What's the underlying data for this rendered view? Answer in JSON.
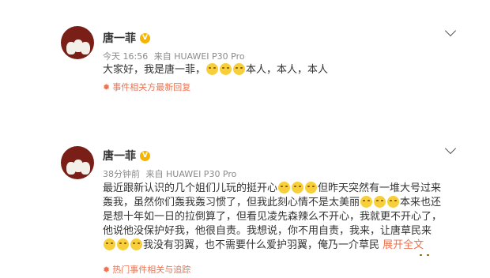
{
  "posts": [
    {
      "author": "唐一菲",
      "verified_icon": "v-badge-icon",
      "time": "今天 16:56",
      "source": "来自 HUAWEI P30 Pro",
      "content": {
        "part1": "大家好，我是唐一菲，",
        "part2": "本人，本人，本人"
      },
      "tracking_label": "事件相关方最新回复"
    },
    {
      "author": "唐一菲",
      "verified_icon": "v-badge-icon",
      "time": "38分钟前",
      "source": "来自 HUAWEI P30 Pro",
      "content": {
        "part1": "最近跟新认识的几个姐们儿玩的挺开心",
        "part2": "但昨天突然有一堆大号过来轰我，虽然你们轰我轰习惯了，但我此刻心情不是太美丽",
        "part3": "本来也还是想十年如一日的拉倒算了，但看见凌先森辣么不开心，我就更不开心了，他说他没保护好我，他很自责。我想说，你不用自责，我来，让唐草民来",
        "part4": "我没有羽翼，也不需要什么爱护羽翼，俺乃一介草民"
      },
      "expand_label": "展开全文",
      "tracking_label": "热门事件相关与追踪"
    }
  ]
}
